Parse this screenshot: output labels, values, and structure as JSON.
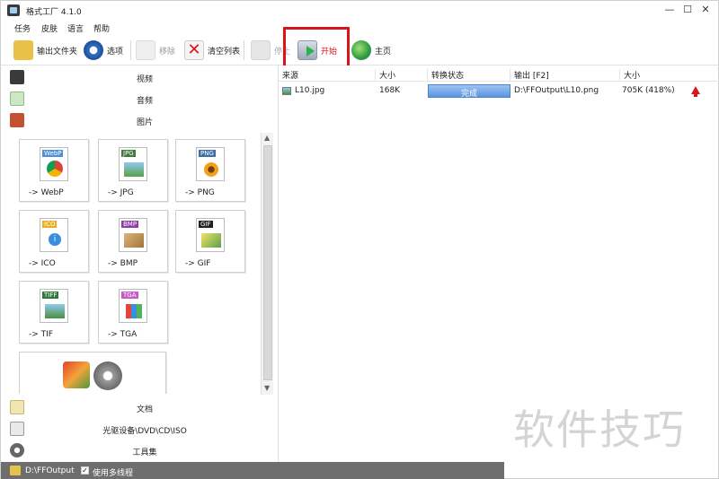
{
  "window": {
    "title": "格式工厂 4.1.0",
    "minimize": "—",
    "maximize": "☐",
    "close": "✕"
  },
  "menu": [
    "任务",
    "皮肤",
    "语言",
    "帮助"
  ],
  "toolbar": {
    "output_folder": "输出文件夹",
    "options": "选项",
    "remove": "移除",
    "clear_list": "清空列表",
    "stop": "停止",
    "start": "开始",
    "home": "主页"
  },
  "categories": {
    "video": "视频",
    "audio": "音频",
    "image": "图片",
    "document": "文档",
    "optical": "光驱设备\\DVD\\CD\\ISO",
    "toolset": "工具集"
  },
  "formats": [
    {
      "label": "-> WebP",
      "badge": "WebP",
      "color": "#4e8fd8"
    },
    {
      "label": "-> JPG",
      "badge": "JPG",
      "color": "#3f7a39"
    },
    {
      "label": "-> PNG",
      "badge": "PNG",
      "color": "#3f6fa8"
    },
    {
      "label": "-> ICO",
      "badge": "ICO",
      "color": "#e8b020"
    },
    {
      "label": "-> BMP",
      "badge": "BMP",
      "color": "#8c3fa6"
    },
    {
      "label": "-> GIF",
      "badge": "GIF",
      "color": "#222222"
    },
    {
      "label": "-> TIF",
      "badge": "TIFF",
      "color": "#2f7a3a"
    },
    {
      "label": "-> TGA",
      "badge": "TGA",
      "color": "#c75ac7"
    }
  ],
  "table": {
    "headers": [
      "来源",
      "大小",
      "转换状态",
      "输出 [F2]",
      "大小"
    ],
    "rows": [
      {
        "source": "L10.jpg",
        "size": "168K",
        "status": "完成",
        "progress": 1.0,
        "output": "D:\\FFOutput\\L10.png",
        "out_size": "705K (418%)"
      }
    ]
  },
  "statusbar": {
    "path": "D:\\FFOutput",
    "multithread_label": "使用多线程",
    "multithread_checked": "✓"
  },
  "watermark": "软件技巧",
  "colors": {
    "accent": "#d9141b",
    "progress": "#6fa3e6",
    "status_bar": "#6e6e6e"
  }
}
